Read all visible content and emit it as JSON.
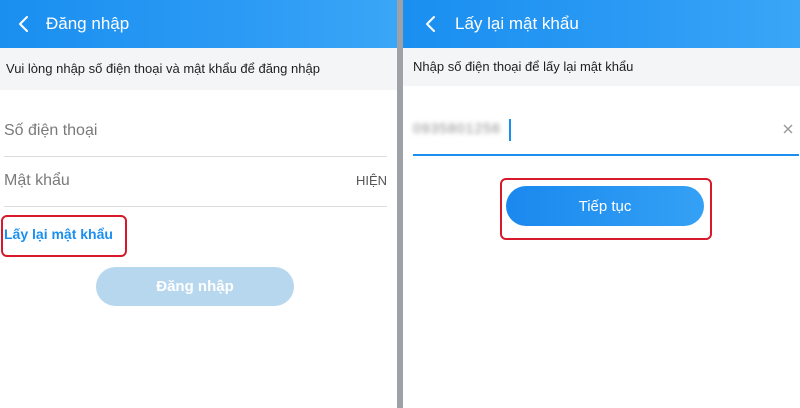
{
  "login_screen": {
    "header": {
      "title": "Đăng nhập"
    },
    "instruction": "Vui lòng nhập số điện thoại và mật khẩu để đăng nhập",
    "phone_field": {
      "placeholder": "Số điện thoại"
    },
    "password_field": {
      "placeholder": "Mật khẩu",
      "show_label": "HIỆN"
    },
    "forgot_password_link": "Lấy lại mật khẩu",
    "login_button": "Đăng nhập"
  },
  "recover_screen": {
    "header": {
      "title": "Lấy lại mật khẩu"
    },
    "instruction": "Nhập số điện thoại để lấy lại mật khẩu",
    "phone_field": {
      "value": "0935801256"
    },
    "continue_button": "Tiếp tục"
  },
  "colors": {
    "header_blue": "#1a8ff0",
    "highlight_red": "#d6192b",
    "disabled_button": "#b7d7ee"
  },
  "icons": [
    "chevron-left-icon",
    "close-icon"
  ]
}
